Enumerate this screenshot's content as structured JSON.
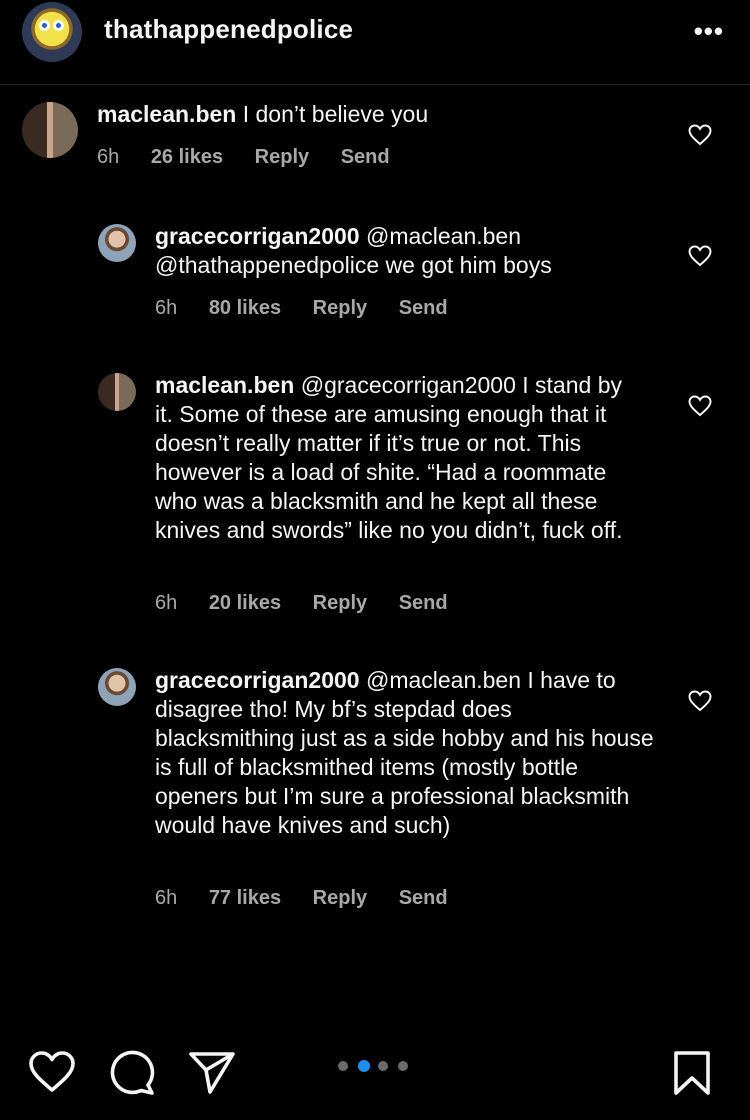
{
  "header": {
    "username": "thathappenedpolice",
    "more_label": "•••"
  },
  "comments": [
    {
      "user": "maclean.ben",
      "text": "I don’t believe you",
      "time": "6h",
      "likes": "26 likes",
      "reply": "Reply",
      "send": "Send"
    },
    {
      "user": "gracecorrigan2000",
      "text": "@maclean.ben @thathappenedpolice we got him boys",
      "time": "6h",
      "likes": "80 likes",
      "reply": "Reply",
      "send": "Send"
    },
    {
      "user": "maclean.ben",
      "text": "@gracecorrigan2000 I stand by it. Some of these are amusing enough that it doesn’t really matter if it’s true or not. This however is a load of shite. “Had a roommate who was a blacksmith and he kept all these knives and swords” like no you didn’t, fuck off.",
      "time": "6h",
      "likes": "20 likes",
      "reply": "Reply",
      "send": "Send"
    },
    {
      "user": "gracecorrigan2000",
      "text": "@maclean.ben I have to disagree tho! My bf’s stepdad does blacksmithing just as a side hobby and his house is full of blacksmithed items (mostly bottle openers but I’m sure a professional blacksmith would have knives and such)",
      "time": "6h",
      "likes": "77 likes",
      "reply": "Reply",
      "send": "Send"
    }
  ],
  "bottom_bar": {
    "icons": [
      "heart-icon",
      "comment-icon",
      "share-icon",
      "bookmark-icon"
    ],
    "carousel_pages": 4,
    "carousel_active_index": 1,
    "accent_color": "#1e8ff0"
  }
}
